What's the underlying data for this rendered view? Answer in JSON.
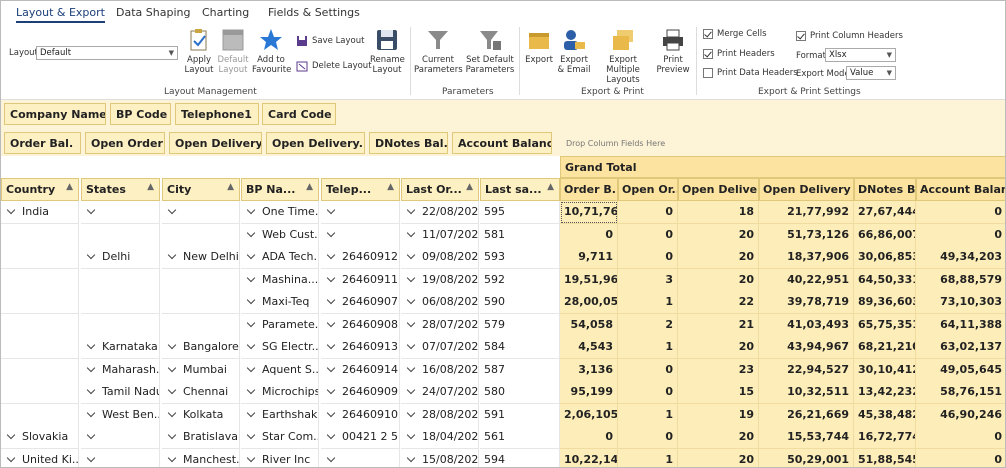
{
  "tabs": [
    "Layout & Export",
    "Data Shaping",
    "Charting",
    "Fields & Settings"
  ],
  "layout": {
    "label": "Layout",
    "value": "Default"
  },
  "ribbon": {
    "layout_management": {
      "label": "Layout Management",
      "apply": "Apply Layout",
      "default": "Default Layout",
      "favourite": "Add to Favourite",
      "save": "Save Layout",
      "delete": "Delete Layout",
      "rename": "Rename Layout"
    },
    "parameters": {
      "label": "Parameters",
      "current": "Current Parameters",
      "set_default": "Set Default Parameters"
    },
    "export_print": {
      "label": "Export & Print",
      "export": "Export",
      "export_email": "Export & Email",
      "export_multiple": "Export Multiple Layouts",
      "print_preview": "Print Preview"
    },
    "settings": {
      "label": "Export & Print Settings",
      "merge_cells": "Merge Cells",
      "print_headers": "Print Headers",
      "print_data_headers": "Print Data Headers",
      "print_column_headers": "Print Column Headers",
      "format_label": "Format",
      "format_value": "Xlsx",
      "export_mode_label": "Export Mode",
      "export_mode_value": "Value",
      "merge_cells_on": true,
      "print_headers_on": true,
      "print_data_headers_on": false,
      "print_column_headers_on": true
    }
  },
  "filter_fields": [
    "Company Name",
    "BP Code",
    "Telephone1",
    "Card Code"
  ],
  "data_fields": [
    "Order Bal.",
    "Open Order",
    "Open Delivery",
    "Open Delivery...",
    "DNotes Bal.",
    "Account Balance"
  ],
  "drop_hint": "Drop Column Fields Here",
  "grand_total": "Grand Total",
  "row_headers": [
    "Country",
    "States",
    "City",
    "BP Na...",
    "Telep...",
    "Last Or...",
    "Last sa..."
  ],
  "value_headers": [
    "Order B...",
    "Open Or...",
    "Open Delivery",
    "Open Delivery B...",
    "DNotes B...",
    "Account Balan..."
  ],
  "rows": [
    {
      "country": "India",
      "state": "",
      "city": "",
      "bp": "One Time...",
      "tel": "",
      "date": "22/08/2025",
      "last": "595",
      "v": [
        "10,71,767",
        "0",
        "18",
        "21,77,992",
        "27,67,444",
        "0"
      ]
    },
    {
      "country": "",
      "state": "",
      "city": "",
      "bp": "Web Cust...",
      "tel": "",
      "date": "11/07/2025",
      "last": "581",
      "v": [
        "0",
        "0",
        "20",
        "51,73,126",
        "66,86,007",
        "0"
      ]
    },
    {
      "country": "",
      "state": "Delhi",
      "city": "New Delhi",
      "bp": "ADA Tech...",
      "tel": "26460912",
      "date": "09/08/2025",
      "last": "593",
      "v": [
        "9,711",
        "0",
        "20",
        "18,37,906",
        "30,06,853",
        "49,34,203"
      ]
    },
    {
      "country": "",
      "state": "",
      "city": "",
      "bp": "Mashina...",
      "tel": "26460911",
      "date": "19/08/2025",
      "last": "592",
      "v": [
        "19,51,961",
        "3",
        "20",
        "40,22,951",
        "64,50,331",
        "68,88,579"
      ]
    },
    {
      "country": "",
      "state": "",
      "city": "",
      "bp": "Maxi-Teq",
      "tel": "26460907",
      "date": "06/08/2025",
      "last": "590",
      "v": [
        "28,00,050",
        "1",
        "22",
        "39,78,719",
        "89,36,603",
        "73,10,303"
      ]
    },
    {
      "country": "",
      "state": "",
      "city": "",
      "bp": "Paramete...",
      "tel": "26460908",
      "date": "28/07/2025",
      "last": "579",
      "v": [
        "54,058",
        "2",
        "21",
        "41,03,493",
        "65,75,351",
        "64,11,388"
      ]
    },
    {
      "country": "",
      "state": "Karnataka",
      "city": "Bangalore",
      "bp": "SG Electr...",
      "tel": "26460913",
      "date": "07/07/2025",
      "last": "584",
      "v": [
        "4,543",
        "1",
        "20",
        "43,94,967",
        "68,21,210",
        "63,02,137"
      ]
    },
    {
      "country": "",
      "state": "Maharash...",
      "city": "Mumbai",
      "bp": "Aquent S...",
      "tel": "26460914",
      "date": "16/08/2025",
      "last": "587",
      "v": [
        "3,136",
        "0",
        "23",
        "22,94,527",
        "30,10,412",
        "49,05,645"
      ]
    },
    {
      "country": "",
      "state": "Tamil Nadu",
      "city": "Chennai",
      "bp": "Microchips",
      "tel": "26460909",
      "date": "24/07/2025",
      "last": "580",
      "v": [
        "95,199",
        "0",
        "15",
        "10,32,511",
        "13,42,232",
        "58,76,151"
      ]
    },
    {
      "country": "",
      "state": "West Ben...",
      "city": "Kolkata",
      "bp": "Earthshak...",
      "tel": "26460910",
      "date": "28/08/2025",
      "last": "591",
      "v": [
        "2,06,105",
        "1",
        "19",
        "26,21,669",
        "45,38,482",
        "46,90,246"
      ]
    },
    {
      "country": "Slovakia",
      "state": "",
      "city": "Bratislava",
      "bp": "Star Com...",
      "tel": "00421 2 5...",
      "date": "18/04/2025",
      "last": "561",
      "v": [
        "0",
        "0",
        "20",
        "15,53,744",
        "16,72,774",
        "0"
      ]
    },
    {
      "country": "United Ki...",
      "state": "",
      "city": "Manchest...",
      "bp": "River Inc",
      "tel": "",
      "date": "15/08/2025",
      "last": "594",
      "v": [
        "10,22,140",
        "1",
        "20",
        "50,29,001",
        "51,88,545",
        "0"
      ]
    }
  ]
}
